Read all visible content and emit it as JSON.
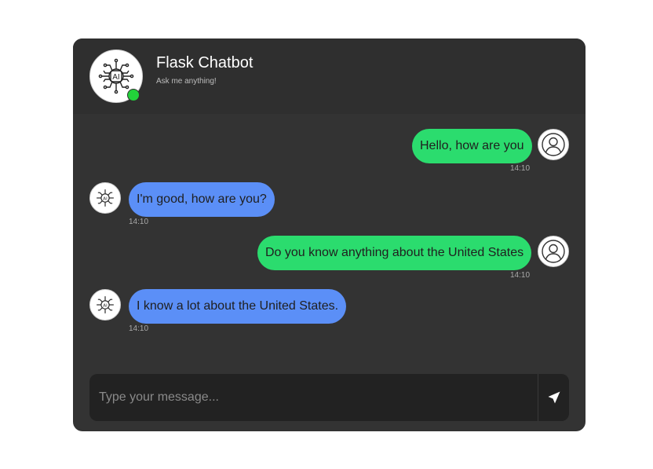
{
  "header": {
    "title": "Flask Chatbot",
    "subtitle": "Ask me anything!",
    "bot_avatar_text": "AI",
    "status_color": "#22d13a"
  },
  "messages": [
    {
      "sender": "user",
      "text": "Hello, how are you",
      "time": "14:10"
    },
    {
      "sender": "bot",
      "text": "I'm good, how are you?",
      "time": "14:10"
    },
    {
      "sender": "user",
      "text": "Do you know anything about the United States",
      "time": "14:10"
    },
    {
      "sender": "bot",
      "text": "I know a lot about the United States.",
      "time": "14:10"
    }
  ],
  "input": {
    "placeholder": "Type your message...",
    "value": ""
  },
  "icons": {
    "send": "send-icon",
    "user": "user-icon",
    "bot": "ai-chip-icon"
  },
  "colors": {
    "user_bubble": "#2bdc6e",
    "bot_bubble": "#5b8ff7",
    "panel": "#333333"
  }
}
